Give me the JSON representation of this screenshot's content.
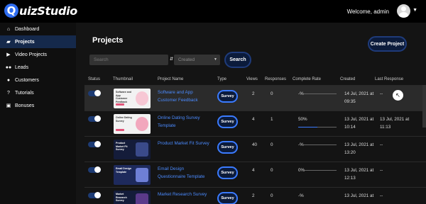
{
  "app": {
    "logo_letter": "Q",
    "logo_text": "uizStudio",
    "welcome": "Welcome, admin"
  },
  "sidebar": {
    "items": [
      {
        "label": "Dashboard",
        "icon": "home-icon"
      },
      {
        "label": "Projects",
        "icon": "folder-icon",
        "active": true
      },
      {
        "label": "Video Projects",
        "icon": "play-icon"
      },
      {
        "label": "Leads",
        "icon": "users-icon"
      },
      {
        "label": "Customers",
        "icon": "user-icon"
      },
      {
        "label": "Tutorials",
        "icon": "help-icon"
      },
      {
        "label": "Bonuses",
        "icon": "gift-icon"
      }
    ]
  },
  "main": {
    "title": "Projects",
    "create_label": "Create Project",
    "search_placeholder": "Search",
    "sort_select": "Created",
    "search_label": "Search"
  },
  "table": {
    "headers": {
      "status": "Status",
      "thumbnail": "Thumbnail",
      "name": "Project Name",
      "type": "Type",
      "views": "Views",
      "responses": "Responses",
      "complete": "Complete Rate",
      "created": "Created",
      "last": "Last Response"
    },
    "rows": [
      {
        "name": "Software and App Customer Feedback",
        "type": "Survey",
        "views": "2",
        "responses": "0",
        "rate": "-%",
        "rate_value": 0,
        "created": "14 Jul, 2021 at 09:35",
        "last": "--",
        "thumb_title": "Software and App Customer Feedback",
        "thumb_style": "light"
      },
      {
        "name": "Online Dating Survey Template",
        "type": "Survey",
        "views": "4",
        "responses": "1",
        "rate": "50%",
        "rate_value": 0.5,
        "created": "13 Jul, 2021 at 10:14",
        "last": "13 Jul, 2021 at 11:13",
        "thumb_title": "Online Dating Survey",
        "thumb_style": "light"
      },
      {
        "name": "Product Market Fit Survey",
        "type": "Survey",
        "views": "40",
        "responses": "0",
        "rate": "-%",
        "rate_value": 0,
        "created": "13 Jul, 2021 at 13:20",
        "last": "--",
        "thumb_title": "Product Market Fit Survey",
        "thumb_style": "dark"
      },
      {
        "name": "Email Design Questionnaire Template",
        "type": "Survey",
        "views": "4",
        "responses": "0",
        "rate": "0%",
        "rate_value": 0,
        "created": "13 Jul, 2021 at 12:13",
        "last": "--",
        "thumb_title": "Email Design Template",
        "thumb_style": "dark"
      },
      {
        "name": "Market Research Survey",
        "type": "Survey",
        "views": "2",
        "responses": "0",
        "rate": "-%",
        "rate_value": 0,
        "created": "13 Jul, 2021 at",
        "last": "--",
        "thumb_title": "Market Research Survey",
        "thumb_style": "dark"
      }
    ]
  },
  "colors": {
    "accent": "#3b7bff",
    "active_sidebar": "#15294b",
    "button_bg": "#0b1b3b"
  }
}
